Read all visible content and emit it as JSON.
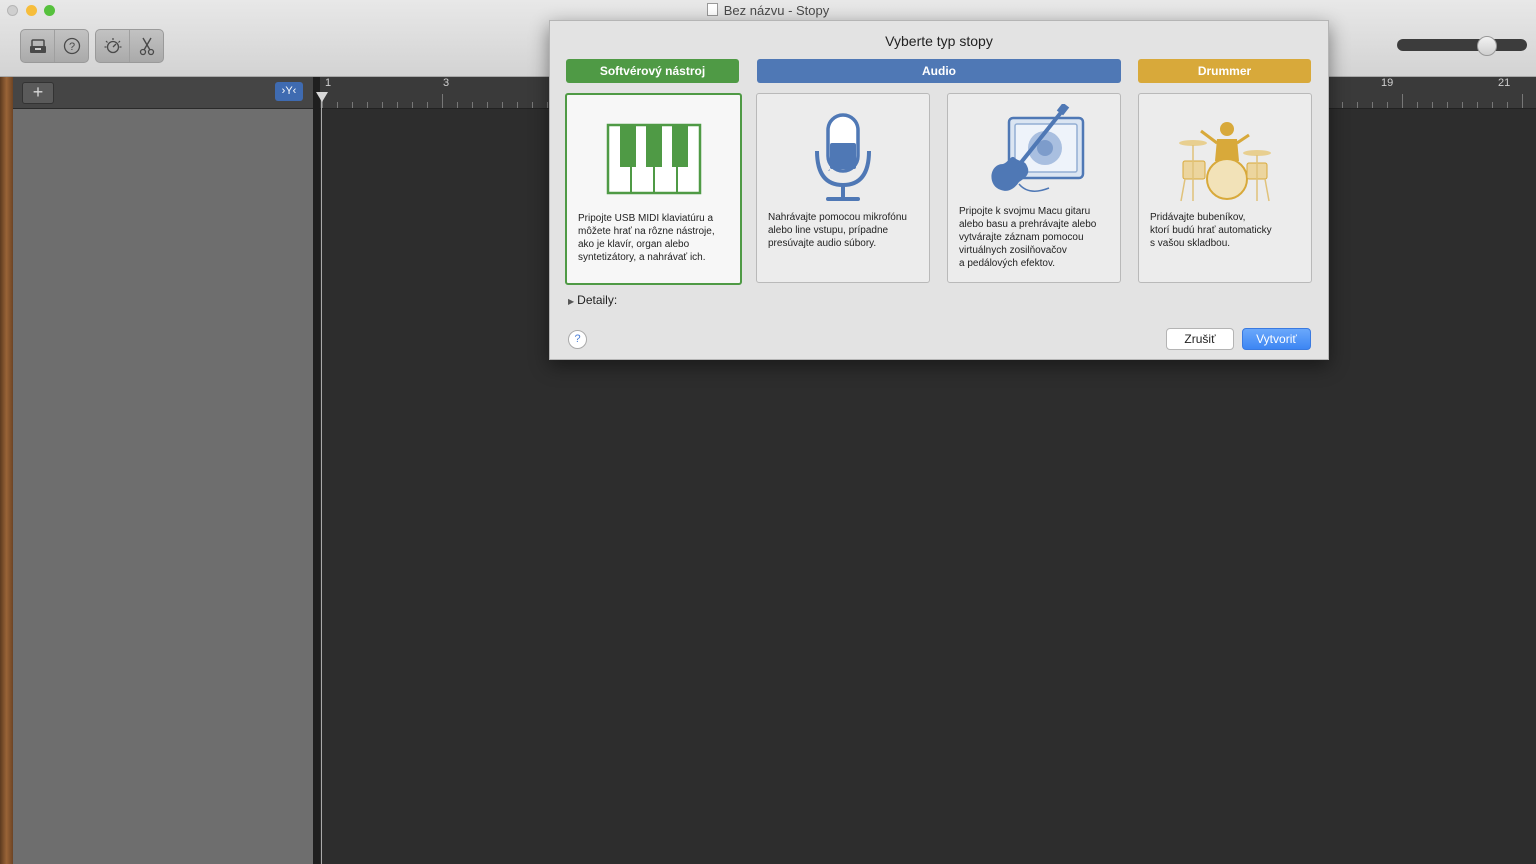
{
  "window": {
    "title": "Bez názvu - Stopy"
  },
  "colors": {
    "software_green": "#4f9a45",
    "audio_blue": "#4f78b5",
    "drummer_gold": "#d8a93a",
    "accent_blue": "#3d86f3"
  },
  "toolbar": {
    "icons": [
      "library-icon",
      "help-icon",
      "smart-controls-icon",
      "scissors-icon"
    ]
  },
  "tracks_header": {
    "add_label": "+",
    "filter_label": "›Y‹"
  },
  "ruler": {
    "labels": [
      "1",
      "3",
      "19",
      "21"
    ]
  },
  "dialog": {
    "title": "Vyberte typ stopy",
    "categories": [
      {
        "label": "Softvérový nástroj"
      },
      {
        "label": "Audio"
      },
      {
        "label": "Drummer"
      }
    ],
    "cards": [
      {
        "icon": "piano-keys-icon",
        "lines": [
          "Pripojte USB MIDI klaviatúru a",
          "môžete hrať na rôzne nástroje,",
          "ako je klavír, organ alebo",
          "syntetizátory, a nahrávať ich."
        ]
      },
      {
        "icon": "microphone-icon",
        "lines": [
          "Nahrávajte pomocou mikrofónu",
          "alebo line vstupu, prípadne",
          "presúvajte audio súbory."
        ]
      },
      {
        "icon": "guitar-amp-icon",
        "lines": [
          "Pripojte k svojmu Macu gitaru",
          "alebo basu a prehrávajte alebo",
          "vytvárajte záznam pomocou",
          "virtuálnych zosilňovačov",
          "a pedálových efektov."
        ]
      },
      {
        "icon": "drummer-icon",
        "lines": [
          "Pridávajte bubeníkov,",
          "ktorí budú hrať automaticky",
          "s vašou skladbou."
        ]
      }
    ],
    "details_label": "Detaily:",
    "help_label": "?",
    "cancel_label": "Zrušiť",
    "create_label": "Vytvoriť"
  }
}
